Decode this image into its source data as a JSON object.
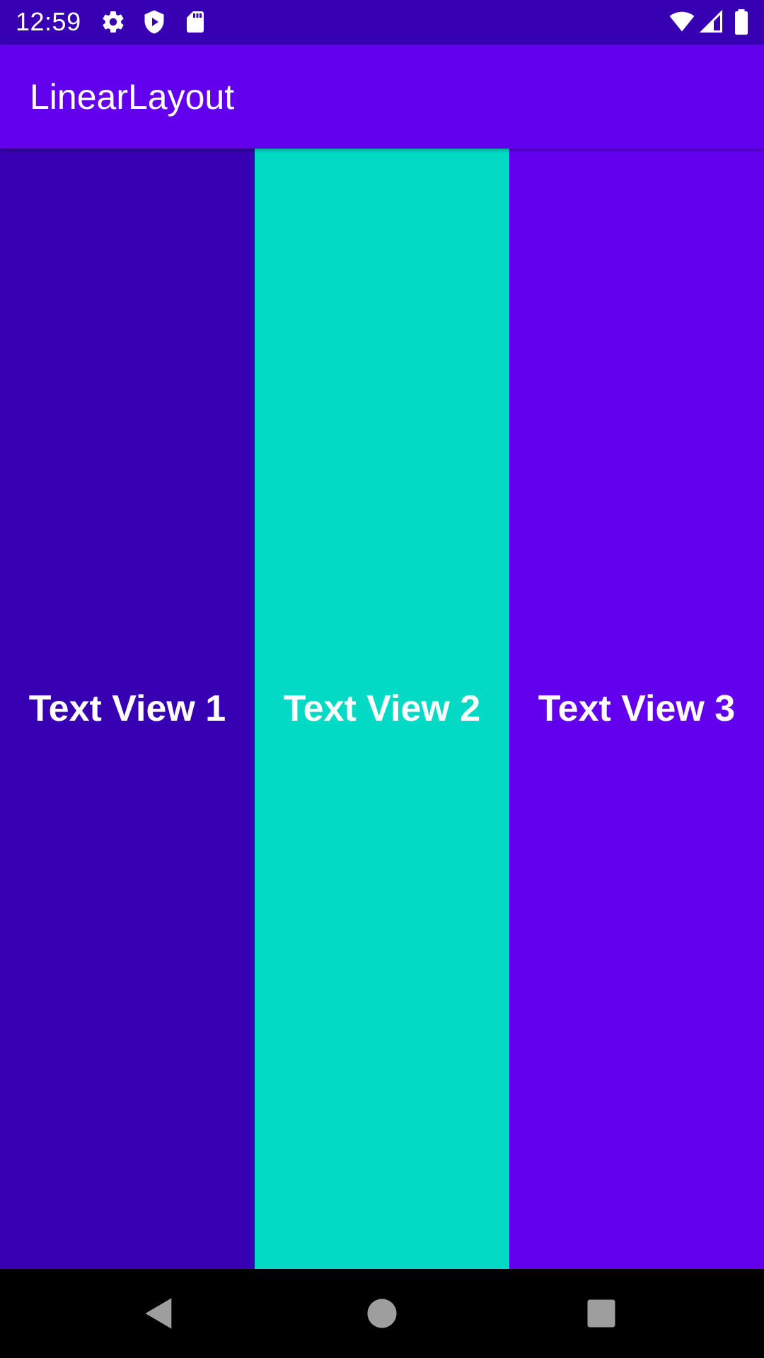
{
  "status_bar": {
    "time": "12:59",
    "icons_left": [
      "gear-icon",
      "shield-play-icon",
      "sd-card-icon"
    ],
    "icons_right": [
      "wifi-icon",
      "cell-signal-icon",
      "battery-icon"
    ],
    "background": "#3700B3"
  },
  "app_bar": {
    "title": "LinearLayout",
    "background": "#6200EE"
  },
  "panels": [
    {
      "label": "Text View 1",
      "color": "#3700B3"
    },
    {
      "label": "Text View 2",
      "color": "#03DAC5"
    },
    {
      "label": "Text View 3",
      "color": "#6200EE"
    }
  ],
  "nav_bar": {
    "buttons": [
      "back-icon",
      "home-icon",
      "recents-icon"
    ],
    "icon_color": "#9E9E9E"
  }
}
